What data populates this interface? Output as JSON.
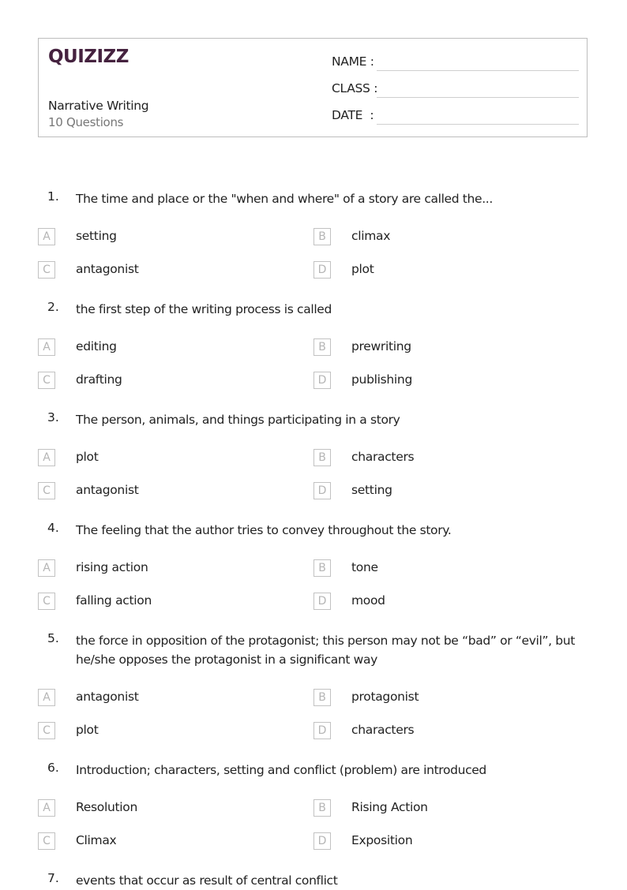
{
  "header": {
    "logo": "QUIZIZZ",
    "title": "Narrative Writing",
    "question_count": "10 Questions",
    "fields": [
      {
        "label": "NAME :"
      },
      {
        "label": "CLASS :"
      },
      {
        "label": "DATE  :"
      }
    ]
  },
  "questions": [
    {
      "number": "1.",
      "text": "The time and place or the \"when and where\" of a story are called the...",
      "options": [
        {
          "letter": "A",
          "text": "setting"
        },
        {
          "letter": "B",
          "text": "climax"
        },
        {
          "letter": "C",
          "text": "antagonist"
        },
        {
          "letter": "D",
          "text": "plot"
        }
      ]
    },
    {
      "number": "2.",
      "text": "the first step of the writing process is called",
      "options": [
        {
          "letter": "A",
          "text": "editing"
        },
        {
          "letter": "B",
          "text": "prewriting"
        },
        {
          "letter": "C",
          "text": "drafting"
        },
        {
          "letter": "D",
          "text": "publishing"
        }
      ]
    },
    {
      "number": "3.",
      "text": "The person, animals, and things participating in a story",
      "options": [
        {
          "letter": "A",
          "text": "plot"
        },
        {
          "letter": "B",
          "text": "characters"
        },
        {
          "letter": "C",
          "text": "antagonist"
        },
        {
          "letter": "D",
          "text": "setting"
        }
      ]
    },
    {
      "number": "4.",
      "text": "The feeling that the author tries to convey throughout the story.",
      "options": [
        {
          "letter": "A",
          "text": "rising action"
        },
        {
          "letter": "B",
          "text": "tone"
        },
        {
          "letter": "C",
          "text": "falling action"
        },
        {
          "letter": "D",
          "text": "mood"
        }
      ]
    },
    {
      "number": "5.",
      "text": "the force in opposition of the protagonist; this person may not be “bad” or “evil”, but he/she opposes the protagonist in a significant way",
      "options": [
        {
          "letter": "A",
          "text": "antagonist"
        },
        {
          "letter": "B",
          "text": "protagonist"
        },
        {
          "letter": "C",
          "text": "plot"
        },
        {
          "letter": "D",
          "text": "characters"
        }
      ]
    },
    {
      "number": "6.",
      "text": "Introduction; characters, setting and conflict (problem) are introduced",
      "options": [
        {
          "letter": "A",
          "text": "Resolution"
        },
        {
          "letter": "B",
          "text": "Rising Action"
        },
        {
          "letter": "C",
          "text": "Climax"
        },
        {
          "letter": "D",
          "text": "Exposition"
        }
      ]
    },
    {
      "number": "7.",
      "text": "events that occur as result of central conflict",
      "options": []
    }
  ]
}
